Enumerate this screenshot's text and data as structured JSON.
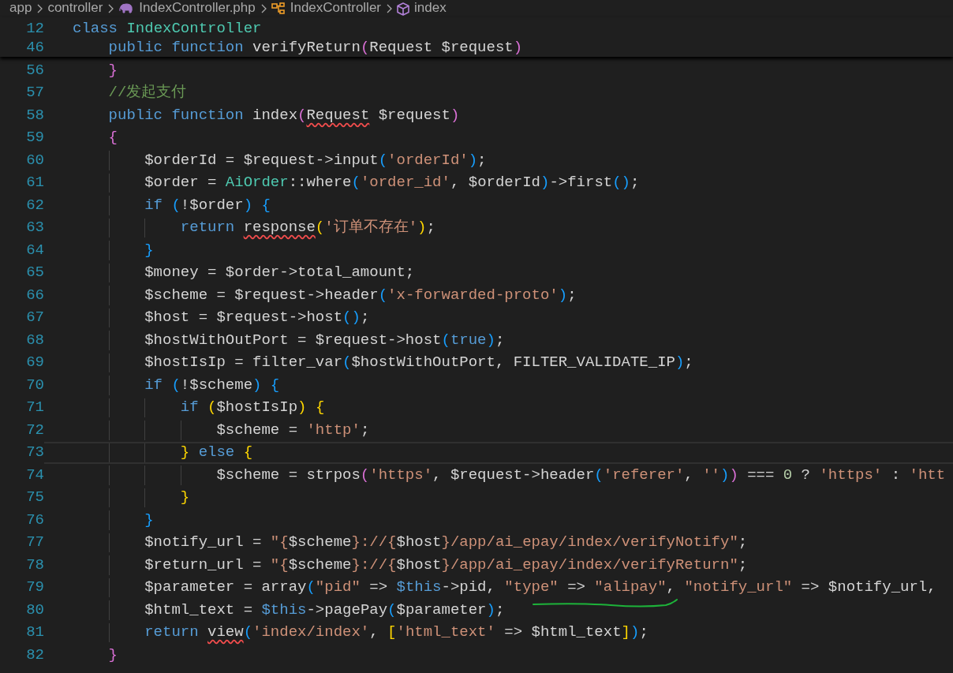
{
  "breadcrumb": [
    {
      "kind": "folder",
      "label": "app"
    },
    {
      "kind": "folder",
      "label": "controller"
    },
    {
      "kind": "php-file",
      "label": "IndexController.php"
    },
    {
      "kind": "class",
      "label": "IndexController"
    },
    {
      "kind": "method",
      "label": "index"
    }
  ],
  "sticky_lines": [
    {
      "number": "12",
      "tokens": [
        {
          "text": "class ",
          "kind": "kw"
        },
        {
          "text": "IndexController",
          "kind": "cls"
        }
      ]
    },
    {
      "number": "46",
      "tokens": [
        {
          "text": "    public ",
          "kind": "kw"
        },
        {
          "text": "function",
          "kind": "kw"
        },
        {
          "text": " verifyReturn",
          "kind": "pl"
        },
        {
          "text": "(",
          "kind": "b2"
        },
        {
          "text": "Request $request",
          "kind": "pl"
        },
        {
          "text": ")",
          "kind": "b2"
        }
      ]
    }
  ],
  "lines": [
    {
      "number": "56",
      "current": false,
      "tokens": [
        {
          "text": "    }",
          "kind": "b2"
        }
      ]
    },
    {
      "number": "57",
      "current": false,
      "tokens": [
        {
          "text": "    //发起支付",
          "kind": "cm"
        }
      ]
    },
    {
      "number": "58",
      "current": false,
      "tokens": [
        {
          "text": "    public ",
          "kind": "kw"
        },
        {
          "text": "function",
          "kind": "kw"
        },
        {
          "text": " index",
          "kind": "pl"
        },
        {
          "text": "(",
          "kind": "b2"
        },
        {
          "text": "Request",
          "kind": "err"
        },
        {
          "text": " $request",
          "kind": "pl"
        },
        {
          "text": ")",
          "kind": "b2"
        }
      ]
    },
    {
      "number": "59",
      "current": false,
      "tokens": [
        {
          "text": "    {",
          "kind": "b2"
        }
      ]
    },
    {
      "number": "60",
      "current": false,
      "tokens": [
        {
          "text": "        $orderId = $request->input",
          "kind": "pl"
        },
        {
          "text": "(",
          "kind": "b3"
        },
        {
          "text": "'orderId'",
          "kind": "str"
        },
        {
          "text": ")",
          "kind": "b3"
        },
        {
          "text": ";",
          "kind": "pl"
        }
      ]
    },
    {
      "number": "61",
      "current": false,
      "tokens": [
        {
          "text": "        $order = ",
          "kind": "pl"
        },
        {
          "text": "AiOrder",
          "kind": "cls"
        },
        {
          "text": "::where",
          "kind": "pl"
        },
        {
          "text": "(",
          "kind": "b3"
        },
        {
          "text": "'order_id'",
          "kind": "str"
        },
        {
          "text": ", $orderId",
          "kind": "pl"
        },
        {
          "text": ")",
          "kind": "b3"
        },
        {
          "text": "->first",
          "kind": "pl"
        },
        {
          "text": "()",
          "kind": "b3"
        },
        {
          "text": ";",
          "kind": "pl"
        }
      ]
    },
    {
      "number": "62",
      "current": false,
      "tokens": [
        {
          "text": "        if ",
          "kind": "kw"
        },
        {
          "text": "(",
          "kind": "b3"
        },
        {
          "text": "!$order",
          "kind": "pl"
        },
        {
          "text": ") ",
          "kind": "b3"
        },
        {
          "text": "{",
          "kind": "b3"
        }
      ]
    },
    {
      "number": "63",
      "current": false,
      "tokens": [
        {
          "text": "            return ",
          "kind": "kw"
        },
        {
          "text": "response",
          "kind": "err"
        },
        {
          "text": "(",
          "kind": "b1"
        },
        {
          "text": "'订单不存在'",
          "kind": "str"
        },
        {
          "text": ")",
          "kind": "b1"
        },
        {
          "text": ";",
          "kind": "pl"
        }
      ]
    },
    {
      "number": "64",
      "current": false,
      "tokens": [
        {
          "text": "        }",
          "kind": "b3"
        }
      ]
    },
    {
      "number": "65",
      "current": false,
      "tokens": [
        {
          "text": "        $money = $order->total_amount;",
          "kind": "pl"
        }
      ]
    },
    {
      "number": "66",
      "current": false,
      "tokens": [
        {
          "text": "        $scheme = $request->header",
          "kind": "pl"
        },
        {
          "text": "(",
          "kind": "b3"
        },
        {
          "text": "'x-forwarded-proto'",
          "kind": "str"
        },
        {
          "text": ")",
          "kind": "b3"
        },
        {
          "text": ";",
          "kind": "pl"
        }
      ]
    },
    {
      "number": "67",
      "current": false,
      "tokens": [
        {
          "text": "        $host = $request->host",
          "kind": "pl"
        },
        {
          "text": "()",
          "kind": "b3"
        },
        {
          "text": ";",
          "kind": "pl"
        }
      ]
    },
    {
      "number": "68",
      "current": false,
      "tokens": [
        {
          "text": "        $hostWithOutPort = $request->host",
          "kind": "pl"
        },
        {
          "text": "(",
          "kind": "b3"
        },
        {
          "text": "true",
          "kind": "kw"
        },
        {
          "text": ")",
          "kind": "b3"
        },
        {
          "text": ";",
          "kind": "pl"
        }
      ]
    },
    {
      "number": "69",
      "current": false,
      "tokens": [
        {
          "text": "        $hostIsIp = filter_var",
          "kind": "pl"
        },
        {
          "text": "(",
          "kind": "b3"
        },
        {
          "text": "$hostWithOutPort, FILTER_VALIDATE_IP",
          "kind": "pl"
        },
        {
          "text": ")",
          "kind": "b3"
        },
        {
          "text": ";",
          "kind": "pl"
        }
      ]
    },
    {
      "number": "70",
      "current": false,
      "tokens": [
        {
          "text": "        if ",
          "kind": "kw"
        },
        {
          "text": "(",
          "kind": "b3"
        },
        {
          "text": "!$scheme",
          "kind": "pl"
        },
        {
          "text": ") ",
          "kind": "b3"
        },
        {
          "text": "{",
          "kind": "b3"
        }
      ]
    },
    {
      "number": "71",
      "current": false,
      "tokens": [
        {
          "text": "            if ",
          "kind": "kw"
        },
        {
          "text": "(",
          "kind": "b1"
        },
        {
          "text": "$hostIsIp",
          "kind": "pl"
        },
        {
          "text": ") ",
          "kind": "b1"
        },
        {
          "text": "{",
          "kind": "b1"
        }
      ]
    },
    {
      "number": "72",
      "current": false,
      "tokens": [
        {
          "text": "                $scheme = ",
          "kind": "pl"
        },
        {
          "text": "'http'",
          "kind": "str"
        },
        {
          "text": ";",
          "kind": "pl"
        }
      ]
    },
    {
      "number": "73",
      "current": true,
      "tokens": [
        {
          "text": "            } ",
          "kind": "b1"
        },
        {
          "text": "else ",
          "kind": "kw"
        },
        {
          "text": "{",
          "kind": "b1"
        }
      ]
    },
    {
      "number": "74",
      "current": false,
      "tokens": [
        {
          "text": "                $scheme = strpos",
          "kind": "pl"
        },
        {
          "text": "(",
          "kind": "b2"
        },
        {
          "text": "'https'",
          "kind": "str"
        },
        {
          "text": ", $request->header",
          "kind": "pl"
        },
        {
          "text": "(",
          "kind": "b3"
        },
        {
          "text": "'referer'",
          "kind": "str"
        },
        {
          "text": ", ",
          "kind": "pl"
        },
        {
          "text": "''",
          "kind": "str"
        },
        {
          "text": ")",
          "kind": "b3"
        },
        {
          "text": ")",
          "kind": "b2"
        },
        {
          "text": " === ",
          "kind": "pl"
        },
        {
          "text": "0",
          "kind": "num"
        },
        {
          "text": " ? ",
          "kind": "pl"
        },
        {
          "text": "'https'",
          "kind": "str"
        },
        {
          "text": " : ",
          "kind": "pl"
        },
        {
          "text": "'htt",
          "kind": "str"
        }
      ]
    },
    {
      "number": "75",
      "current": false,
      "tokens": [
        {
          "text": "            }",
          "kind": "b1"
        }
      ]
    },
    {
      "number": "76",
      "current": false,
      "tokens": [
        {
          "text": "        }",
          "kind": "b3"
        }
      ]
    },
    {
      "number": "77",
      "current": false,
      "tokens": [
        {
          "text": "        $notify_url = ",
          "kind": "pl"
        },
        {
          "text": "\"{",
          "kind": "str"
        },
        {
          "text": "$scheme",
          "kind": "pl"
        },
        {
          "text": "}://{",
          "kind": "str"
        },
        {
          "text": "$host",
          "kind": "pl"
        },
        {
          "text": "}/app/ai_epay/index/verifyNotify\"",
          "kind": "str"
        },
        {
          "text": ";",
          "kind": "pl"
        }
      ]
    },
    {
      "number": "78",
      "current": false,
      "tokens": [
        {
          "text": "        $return_url = ",
          "kind": "pl"
        },
        {
          "text": "\"{",
          "kind": "str"
        },
        {
          "text": "$scheme",
          "kind": "pl"
        },
        {
          "text": "}://{",
          "kind": "str"
        },
        {
          "text": "$host",
          "kind": "pl"
        },
        {
          "text": "}/app/ai_epay/index/verifyReturn\"",
          "kind": "str"
        },
        {
          "text": ";",
          "kind": "pl"
        }
      ]
    },
    {
      "number": "79",
      "current": false,
      "tokens": [
        {
          "text": "        $parameter = array",
          "kind": "pl"
        },
        {
          "text": "(",
          "kind": "b3"
        },
        {
          "text": "\"pid\"",
          "kind": "str"
        },
        {
          "text": " => ",
          "kind": "pl"
        },
        {
          "text": "$this",
          "kind": "kw"
        },
        {
          "text": "->pid, ",
          "kind": "pl"
        },
        {
          "text": "\"type\"",
          "kind": "str"
        },
        {
          "text": " => ",
          "kind": "pl"
        },
        {
          "text": "\"alipay\"",
          "kind": "str"
        },
        {
          "text": ", ",
          "kind": "pl"
        },
        {
          "text": "\"notify_url\"",
          "kind": "str"
        },
        {
          "text": " => $notify_url,",
          "kind": "pl"
        }
      ]
    },
    {
      "number": "80",
      "current": false,
      "tokens": [
        {
          "text": "        $html_text = ",
          "kind": "pl"
        },
        {
          "text": "$this",
          "kind": "kw"
        },
        {
          "text": "->pagePay",
          "kind": "pl"
        },
        {
          "text": "(",
          "kind": "b3"
        },
        {
          "text": "$parameter",
          "kind": "pl"
        },
        {
          "text": ")",
          "kind": "b3"
        },
        {
          "text": ";",
          "kind": "pl"
        }
      ]
    },
    {
      "number": "81",
      "current": false,
      "tokens": [
        {
          "text": "        return ",
          "kind": "kw"
        },
        {
          "text": "view",
          "kind": "err"
        },
        {
          "text": "(",
          "kind": "b3"
        },
        {
          "text": "'index/index'",
          "kind": "str"
        },
        {
          "text": ", ",
          "kind": "pl"
        },
        {
          "text": "[",
          "kind": "b1"
        },
        {
          "text": "'html_text'",
          "kind": "str"
        },
        {
          "text": " => $html_text",
          "kind": "pl"
        },
        {
          "text": "]",
          "kind": "b1"
        },
        {
          "text": ")",
          "kind": "b3"
        },
        {
          "text": ";",
          "kind": "pl"
        }
      ]
    },
    {
      "number": "82",
      "current": false,
      "tokens": [
        {
          "text": "    }",
          "kind": "b2"
        }
      ]
    }
  ]
}
